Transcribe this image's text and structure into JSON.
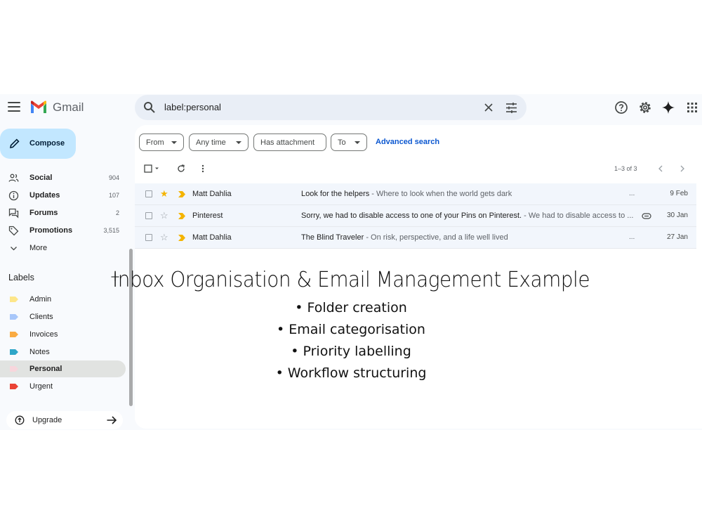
{
  "header": {
    "app_name": "Gmail",
    "search_query": "label:personal",
    "icons": [
      "menu-icon",
      "gmail-logo",
      "search-icon",
      "clear-icon",
      "tune-icon",
      "help-icon",
      "settings-icon",
      "gemini-icon",
      "apps-icon"
    ]
  },
  "compose": {
    "label": "Compose"
  },
  "nav": [
    {
      "label": "Social",
      "count": "904",
      "icon": "people-icon"
    },
    {
      "label": "Updates",
      "count": "107",
      "icon": "info-icon"
    },
    {
      "label": "Forums",
      "count": "2",
      "icon": "forum-icon"
    },
    {
      "label": "Promotions",
      "count": "3,515",
      "icon": "tag-icon"
    },
    {
      "label": "More",
      "count": "",
      "icon": "chevron-down-icon"
    }
  ],
  "labels_section": {
    "title": "Labels",
    "items": [
      {
        "label": "Admin",
        "color": "#fde68a",
        "active": false
      },
      {
        "label": "Clients",
        "color": "#a8c7fa",
        "active": false
      },
      {
        "label": "Invoices",
        "color": "#f9ab42",
        "active": false
      },
      {
        "label": "Notes",
        "color": "#2fa6c8",
        "active": false
      },
      {
        "label": "Personal",
        "color": "#f7d6dc",
        "active": true
      },
      {
        "label": "Urgent",
        "color": "#ea4335",
        "active": false
      }
    ]
  },
  "upgrade": {
    "label": "Upgrade"
  },
  "filters": {
    "chips": [
      "From",
      "Any time",
      "Has attachment",
      "To"
    ],
    "advanced": "Advanced search"
  },
  "list": {
    "pagination": "1–3 of 3",
    "emails": [
      {
        "sender": "Matt Dahlia",
        "subject": "Look for the helpers",
        "snippet": " - Where to look when the world gets dark",
        "date": "9 Feb",
        "starred": true,
        "attachment": false
      },
      {
        "sender": "Pinterest",
        "subject": "Sorry, we had to disable access to one of your Pins on Pinterest.",
        "snippet": " - We had to disable access to ...",
        "date": "30 Jan",
        "starred": false,
        "attachment": true
      },
      {
        "sender": "Matt Dahlia",
        "subject": "The Blind Traveler",
        "snippet": " - On risk, perspective, and a life well lived",
        "date": "27 Jan",
        "starred": false,
        "attachment": false
      }
    ]
  },
  "caption": {
    "title": "Inbox Organisation & Email Management Example",
    "bullets": [
      "• Folder creation",
      "• Email categorisation",
      "• Priority labelling",
      "• Workflow structuring"
    ]
  },
  "colors": {
    "compose_bg": "#c2e7ff",
    "app_bg": "#f8fafd",
    "search_bg": "#e9eef6",
    "link": "#0b57d0",
    "star": "#f4b400",
    "important": "#f4b400"
  }
}
